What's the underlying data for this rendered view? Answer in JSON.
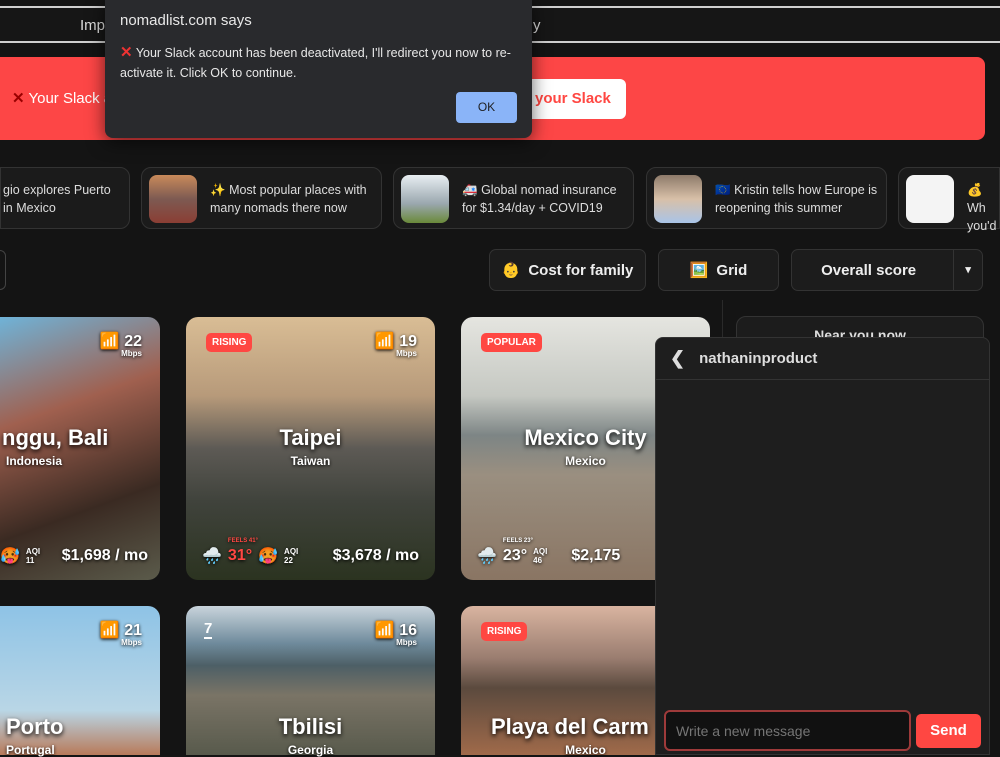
{
  "nav": {
    "left_text": "Imp",
    "right_text": "y"
  },
  "banner": {
    "text": "Your Slack ac",
    "button": "your Slack"
  },
  "dialog": {
    "title": "nomadlist.com says",
    "message": "Your Slack account has been deactivated, I'll redirect you now to re-activate it. Click OK to continue.",
    "ok": "OK"
  },
  "stories": [
    {
      "text": "gio explores Puerto in Mexico"
    },
    {
      "icon": "✨",
      "text": "Most popular places with many nomads there now"
    },
    {
      "icon": "🚑",
      "text": "Global nomad insurance for $1.34/day + COVID19"
    },
    {
      "icon": "🇪🇺",
      "text": "Kristin tells how Europe is reopening this summer"
    },
    {
      "icon": "💰",
      "text": "Wh you'd"
    }
  ],
  "controls": {
    "cost_family": "Cost for family",
    "grid": "Grid",
    "sort": "Overall score"
  },
  "cities": [
    {
      "name": "nggu, Bali",
      "country": "Indonesia",
      "wifi": "22",
      "unit": "Mbps",
      "aqi_label": "AQI",
      "aqi": "11",
      "cost": "$1,698 / mo"
    },
    {
      "name": "Taipei",
      "country": "Taiwan",
      "badge": "RISING",
      "wifi": "19",
      "unit": "Mbps",
      "feels": "FEELS 41°",
      "temp": "31°",
      "aqi_label": "AQI",
      "aqi": "22",
      "cost": "$3,678 / mo"
    },
    {
      "name": "Mexico City",
      "country": "Mexico",
      "badge": "POPULAR",
      "feels": "FEELS 23°",
      "temp": "23°",
      "aqi_label": "AQI",
      "aqi": "46",
      "cost": "$2,175"
    },
    {
      "name": "Porto",
      "country": "Portugal",
      "wifi": "21",
      "unit": "Mbps"
    },
    {
      "name": "Tbilisi",
      "country": "Georgia",
      "rank": "7",
      "wifi": "16",
      "unit": "Mbps"
    },
    {
      "name": "Playa del Carm",
      "country": "Mexico",
      "badge": "RISING"
    }
  ],
  "side": {
    "near_you": "Near you now"
  },
  "chat": {
    "user": "nathaninproduct",
    "placeholder": "Write a new message",
    "send": "Send"
  }
}
